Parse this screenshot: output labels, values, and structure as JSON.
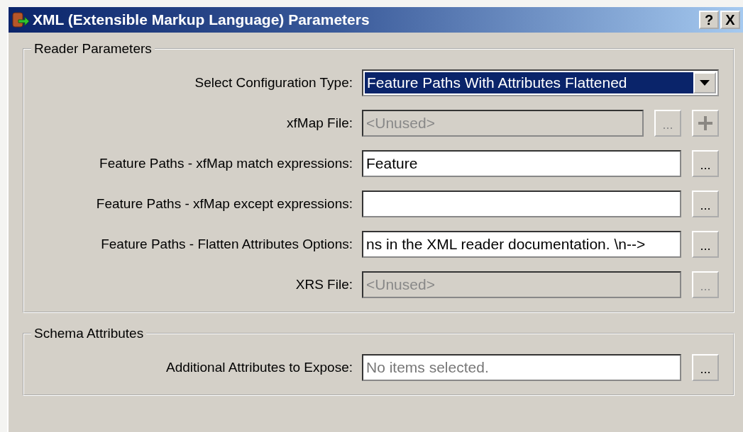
{
  "window": {
    "title": "XML (Extensible Markup Language) Parameters",
    "buttons": [
      "?",
      "X"
    ]
  },
  "groups": [
    {
      "title": "Reader Parameters",
      "rows": [
        {
          "label": "Select Configuration Type:",
          "kind": "combo",
          "value": "Feature Paths With Attributes Flattened",
          "disabled": false,
          "buttons": []
        },
        {
          "label": "xfMap File:",
          "kind": "text",
          "value": "<Unused>",
          "disabled": true,
          "buttons": [
            {
              "kind": "browse",
              "label": "...",
              "disabled": true
            },
            {
              "kind": "add",
              "disabled": true
            }
          ]
        },
        {
          "label": "Feature Paths - xfMap match expressions:",
          "kind": "text",
          "value": "Feature",
          "disabled": false,
          "buttons": [
            {
              "kind": "browse",
              "label": "...",
              "disabled": false
            }
          ]
        },
        {
          "label": "Feature Paths - xfMap except expressions:",
          "kind": "text",
          "disabled": false,
          "buttons": [
            {
              "kind": "browse",
              "label": "...",
              "disabled": false
            }
          ]
        },
        {
          "label": "Feature Paths - Flatten Attributes Options:",
          "kind": "text",
          "value": "ns in the XML reader documentation. \\n-->",
          "disabled": false,
          "buttons": [
            {
              "kind": "browse",
              "label": "...",
              "disabled": false
            }
          ]
        },
        {
          "label": "XRS File:",
          "kind": "text",
          "value": "<Unused>",
          "disabled": true,
          "buttons": [
            {
              "kind": "browse",
              "label": "...",
              "disabled": true
            }
          ]
        }
      ]
    },
    {
      "title": "Schema Attributes",
      "rows": [
        {
          "label": "Additional Attributes to Expose:",
          "kind": "text",
          "placeholder": "No items selected.",
          "disabled": false,
          "buttons": [
            {
              "kind": "browse",
              "label": "...",
              "disabled": false
            }
          ]
        }
      ]
    }
  ]
}
